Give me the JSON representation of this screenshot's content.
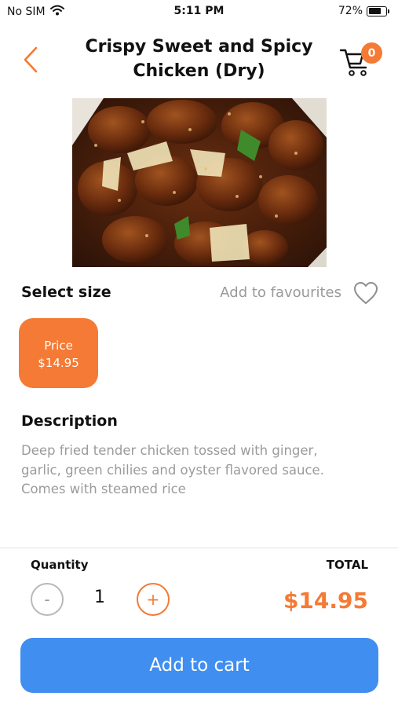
{
  "status_bar": {
    "carrier": "No SIM",
    "time": "5:11 PM",
    "battery": "72%",
    "battery_level": 0.72
  },
  "header": {
    "title_line1": "Crispy Sweet and Spicy",
    "title_line2": "Chicken (Dry)",
    "cart_count": "0"
  },
  "product": {
    "image_icon": "food-photo",
    "select_size_label": "Select size",
    "favourites_label": "Add to favourites",
    "size_option": {
      "label": "Price",
      "price": "$14.95"
    },
    "description_heading": "Description",
    "description": "Deep fried tender chicken tossed with ginger, garlic, green chilies and oyster flavored sauce. Comes with steamed rice"
  },
  "order": {
    "quantity_label": "Quantity",
    "total_label": "TOTAL",
    "minus_symbol": "-",
    "plus_symbol": "+",
    "quantity": "1",
    "total": "$14.95",
    "add_to_cart_label": "Add to cart"
  },
  "colors": {
    "accent": "#f47a35",
    "primary_button": "#3f8ef0",
    "muted_text": "#9b9b9b"
  }
}
